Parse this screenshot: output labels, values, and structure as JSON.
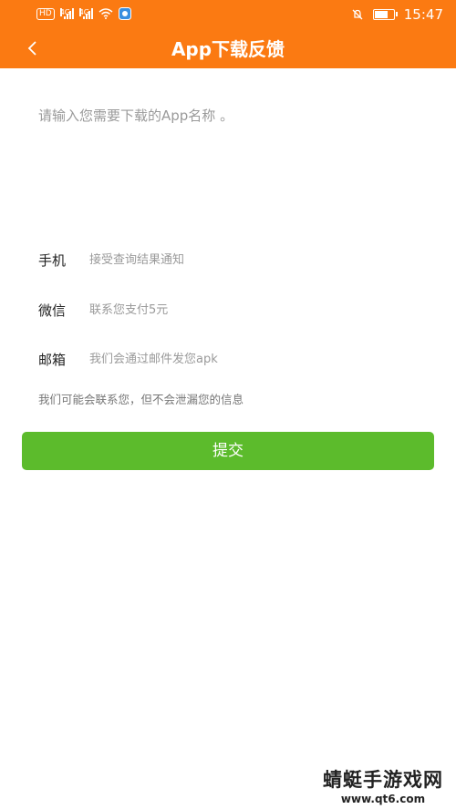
{
  "status_bar": {
    "hd": "HD",
    "signal_1_label": "4G",
    "signal_2_label": "4G",
    "time": "15:47",
    "battery_level": 0.8
  },
  "header": {
    "title": "App下载反馈",
    "back_icon": "chevron-left-icon",
    "background_color": "#fb7a12"
  },
  "form": {
    "app_name_placeholder": "请输入您需要下载的App名称 。",
    "phone": {
      "label": "手机",
      "placeholder": "接受查询结果通知"
    },
    "wechat": {
      "label": "微信",
      "placeholder": "联系您支付5元"
    },
    "email": {
      "label": "邮箱",
      "placeholder": "我们会通过邮件发您apk"
    },
    "notice": "我们可能会联系您，但不会泄漏您的信息",
    "submit_label": "提交",
    "submit_color": "#5cbb2c"
  },
  "watermark": {
    "name": "蜻蜓手游戏网",
    "url": "www.qt6.com"
  }
}
